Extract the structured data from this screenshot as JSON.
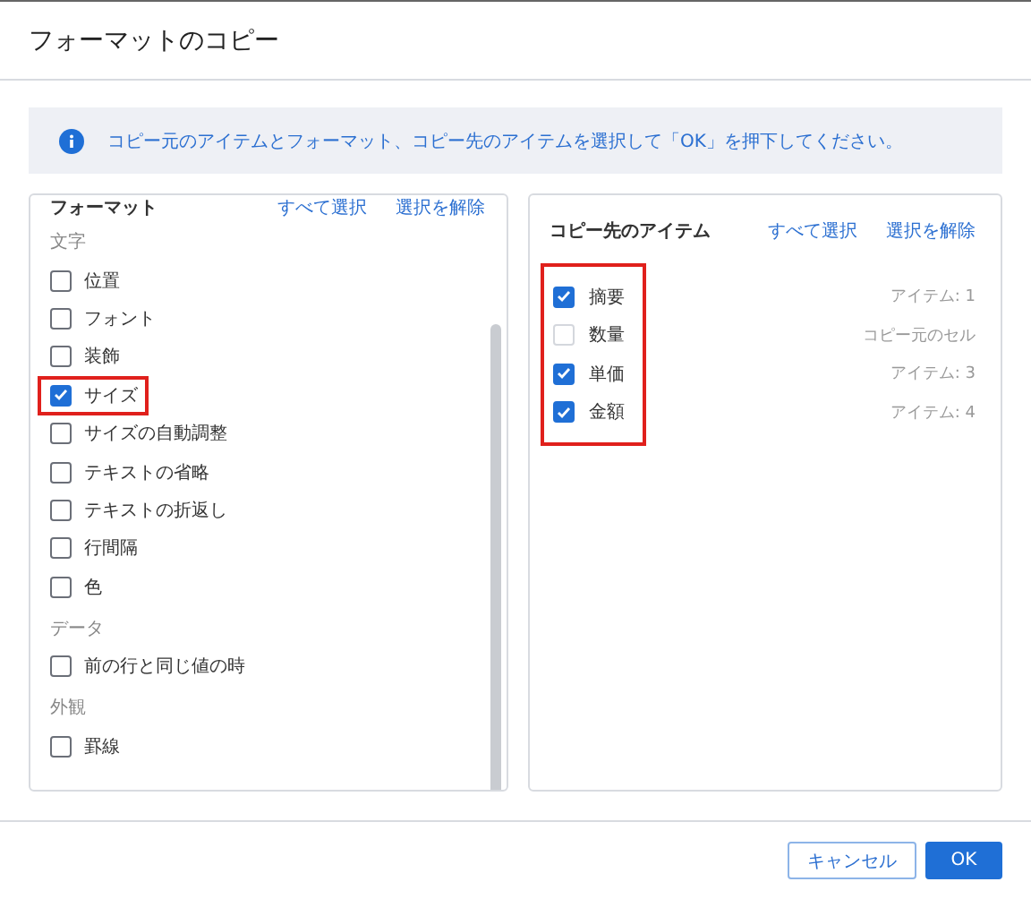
{
  "dialog": {
    "title": "フォーマットのコピー"
  },
  "info": {
    "text": "コピー元のアイテムとフォーマット、コピー先のアイテムを選択して「OK」を押下してください。"
  },
  "format_panel": {
    "title": "フォーマット",
    "select_all": "すべて選択",
    "deselect_all": "選択を解除",
    "sections": [
      {
        "label": "文字",
        "items": [
          {
            "label": "位置",
            "checked": false,
            "highlighted": false
          },
          {
            "label": "フォント",
            "checked": false,
            "highlighted": false
          },
          {
            "label": "装飾",
            "checked": false,
            "highlighted": false
          },
          {
            "label": "サイズ",
            "checked": true,
            "highlighted": true
          },
          {
            "label": "サイズの自動調整",
            "checked": false,
            "highlighted": false
          },
          {
            "label": "テキストの省略",
            "checked": false,
            "highlighted": false
          },
          {
            "label": "テキストの折返し",
            "checked": false,
            "highlighted": false
          },
          {
            "label": "行間隔",
            "checked": false,
            "highlighted": false
          },
          {
            "label": "色",
            "checked": false,
            "highlighted": false
          }
        ]
      },
      {
        "label": "データ",
        "items": [
          {
            "label": "前の行と同じ値の時",
            "checked": false,
            "highlighted": false
          }
        ]
      },
      {
        "label": "外観",
        "items": [
          {
            "label": "罫線",
            "checked": false,
            "highlighted": false
          }
        ]
      }
    ]
  },
  "target_panel": {
    "title": "コピー先のアイテム",
    "select_all": "すべて選択",
    "deselect_all": "選択を解除",
    "highlighted": true,
    "items": [
      {
        "label": "摘要",
        "source": "アイテム: 1",
        "checked": true,
        "disabled": false
      },
      {
        "label": "数量",
        "source": "コピー元のセル",
        "checked": false,
        "disabled": true
      },
      {
        "label": "単価",
        "source": "アイテム: 3",
        "checked": true,
        "disabled": false
      },
      {
        "label": "金額",
        "source": "アイテム: 4",
        "checked": true,
        "disabled": false
      }
    ]
  },
  "buttons": {
    "cancel": "キャンセル",
    "ok": "OK"
  }
}
